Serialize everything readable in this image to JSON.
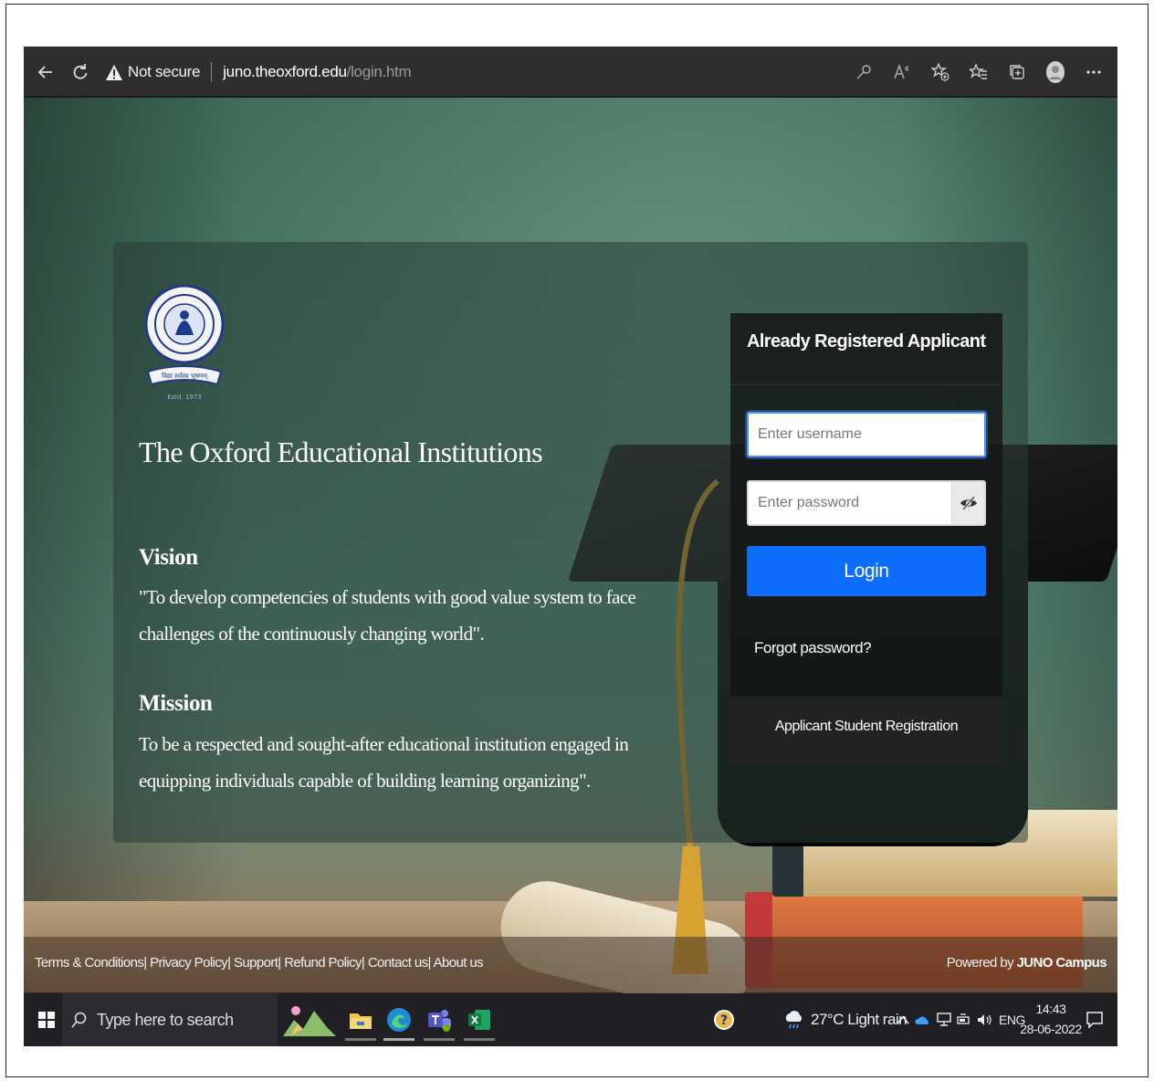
{
  "browser": {
    "security_label": "Not secure",
    "url_host": "juno.theoxford.edu",
    "url_path": "/login.htm"
  },
  "institution": {
    "logo_motto": "विद्या सर्वस्य भूषणम्",
    "logo_est": "Estd. 1973",
    "name": "The Oxford Educational Institutions"
  },
  "vision": {
    "title": "Vision",
    "text": "\"To develop competencies of students with good value system to face challenges of the continuously changing world\"."
  },
  "mission": {
    "title": "Mission",
    "text": "To be a respected and sought-after educational institution engaged in equipping individuals capable of building learning organizing\"."
  },
  "login": {
    "title": "Already Registered Applicant",
    "username_placeholder": "Enter username",
    "password_placeholder": "Enter password",
    "button_label": "Login",
    "forgot_label": "Forgot password?",
    "register_label": "Applicant Student Registration"
  },
  "footer": {
    "links": [
      "Terms & Conditions|",
      "Privacy Policy|",
      "Support|",
      "Refund Policy|",
      "Contact us|",
      "About us"
    ],
    "powered_prefix": "Powered by ",
    "powered_brand": "JUNO Campus"
  },
  "taskbar": {
    "search_placeholder": "Type here to search",
    "weather": "27°C  Light rain",
    "language": "ENG",
    "time": "14:43",
    "date": "28-06-2022"
  }
}
